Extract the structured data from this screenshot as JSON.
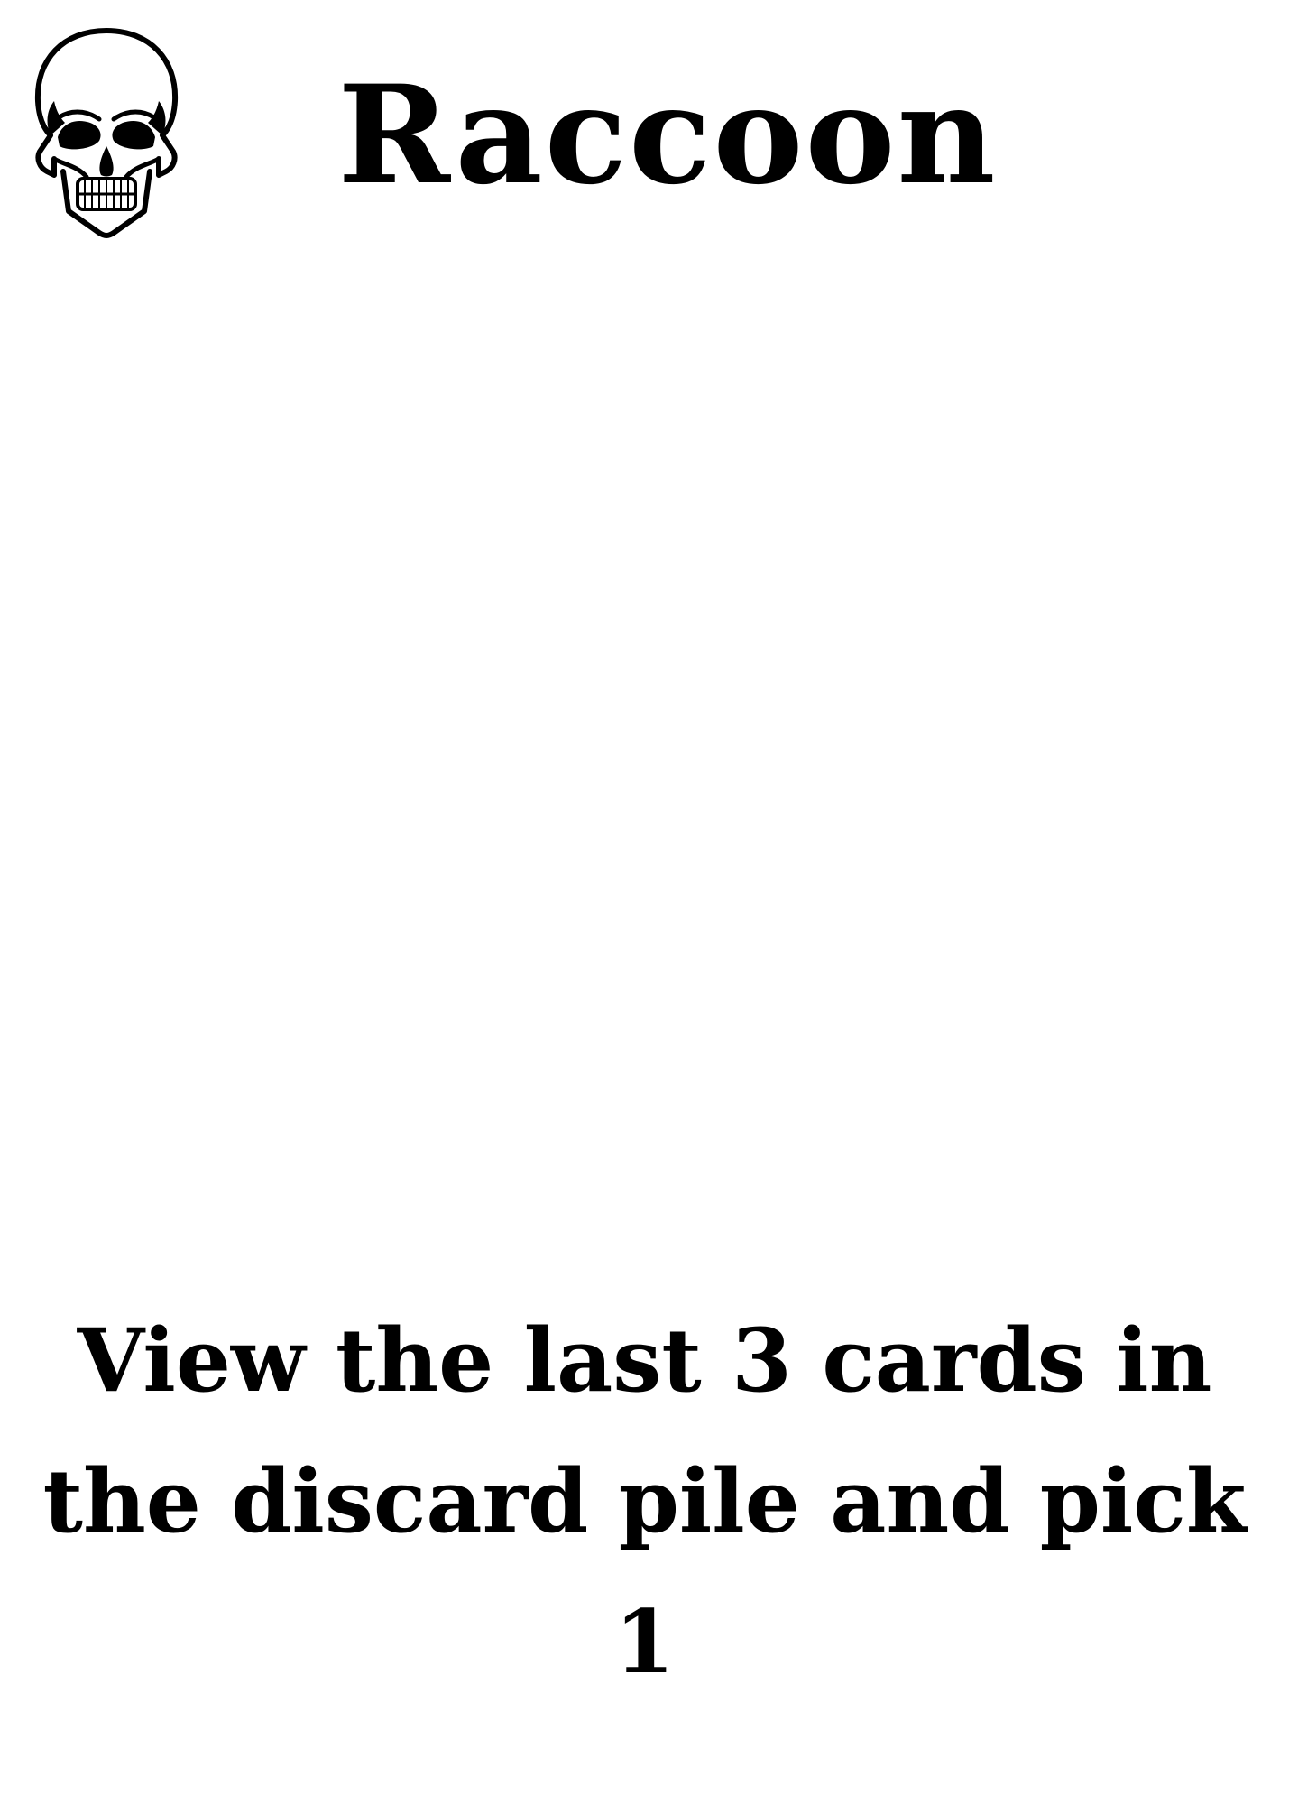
{
  "card": {
    "title": "Raccoon",
    "icon": "skull-icon",
    "effect_text": "View the last 3 cards in the discard pile and pick 1"
  }
}
